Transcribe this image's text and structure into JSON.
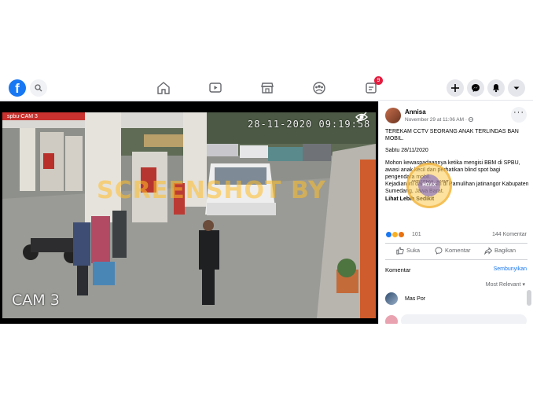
{
  "video": {
    "timestamp": "28-11-2020 09:19:58",
    "camera_label": "CAM 3",
    "sign_text": "spbu-CAM 3",
    "watermark": "SCREENSHOT BY"
  },
  "post": {
    "author": "Annisa",
    "meta": "November 29 at 11:06 AM · ",
    "headline": "TEREKAM CCTV SEORANG ANAK TERLINDAS BAN MOBIL.",
    "date_line": "Sabtu 28/11/2020",
    "body1": "Mohon kewaspadaannya ketika mengisi BBM di SPBU,",
    "body2": "awasi anak kecil dan perhatikan blind spot bagi pengendara mobil.",
    "body3": "Kejadian ini dari Bersih di Pamulihan jatinangor Kabupaten Sumedang, Jawa Barat.",
    "see_more": "Lihat Lebih Sedikit",
    "reaction_count": "101",
    "comment_count": "144 Komentar",
    "hoax_stamp": "HOAX",
    "hoax_ring": "ANTI FITNAH · HASUT · HOAX"
  },
  "actions": {
    "like": "Suka",
    "comment": "Komentar",
    "share": "Bagikan"
  },
  "comments": {
    "section_title": "Komentar",
    "hide_link": "Sembunyikan",
    "sort_label": "Most Relevant",
    "first_commenter": "Mas Por"
  },
  "nav": {
    "notification_badge": "9"
  },
  "colors": {
    "brand": "#1877f2",
    "badge": "#e41e3f",
    "like": "#1877f2",
    "haha": "#f7b125",
    "angry": "#e9710f"
  }
}
